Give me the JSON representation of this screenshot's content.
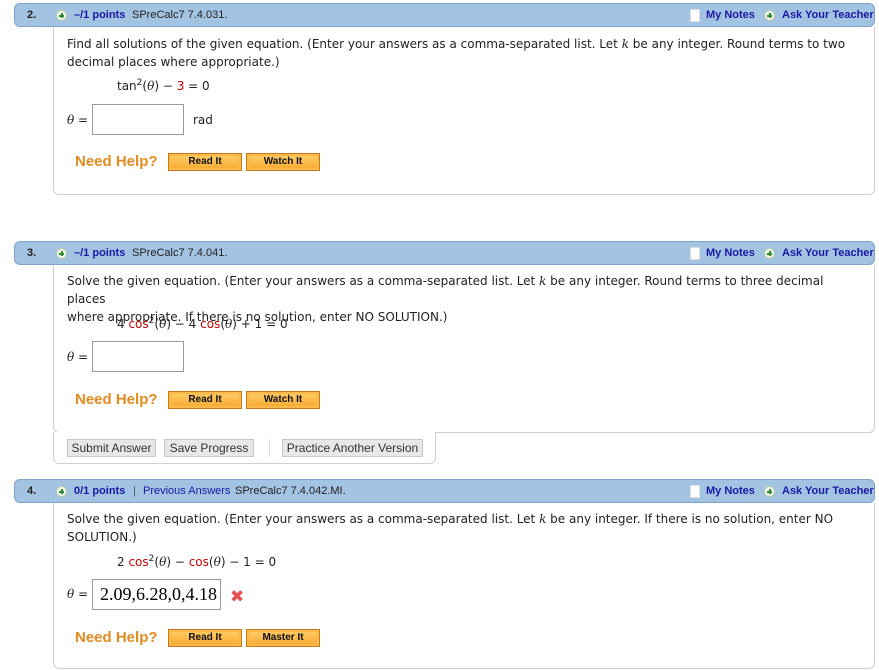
{
  "questions": [
    {
      "number": "2.",
      "points": "–/1 points",
      "source": "SPreCalc7 7.4.031.",
      "my_notes": "My Notes",
      "ask_teacher": "Ask Your Teacher",
      "prompt_line1": "Find all solutions of the given equation. (Enter your answers as a comma-separated list. Let k be any integer. Round terms to two",
      "prompt_line2": "decimal places where appropriate.)",
      "equation": {
        "a": "tan",
        "sup": "2",
        "b": "(θ) − ",
        "c": "3",
        "d": " = 0"
      },
      "theta_label": "θ =",
      "answer_value": "",
      "unit": "rad",
      "need_help": "Need Help?",
      "help_buttons": [
        "Read It",
        "Watch It"
      ]
    },
    {
      "number": "3.",
      "points": "–/1 points",
      "source": "SPreCalc7 7.4.041.",
      "my_notes": "My Notes",
      "ask_teacher": "Ask Your Teacher",
      "prompt_line1": "Solve the given equation. (Enter your answers as a comma-separated list. Let k be any integer. Round terms to three decimal places",
      "prompt_line2": "where appropriate. If there is no solution, enter NO SOLUTION.)",
      "equation": {
        "a": "4 ",
        "b": "cos",
        "sup": "2",
        "c": "(θ) − 4 ",
        "d": "cos",
        "e": "(θ) + 1 = 0"
      },
      "theta_label": "θ =",
      "answer_value": "",
      "need_help": "Need Help?",
      "help_buttons": [
        "Read It",
        "Watch It"
      ],
      "actions": [
        "Submit Answer",
        "Save Progress",
        "Practice Another Version"
      ]
    },
    {
      "number": "4.",
      "points": "0/1 points",
      "separator": "|",
      "previous_answers": "Previous Answers",
      "source": "SPreCalc7 7.4.042.MI.",
      "my_notes": "My Notes",
      "ask_teacher": "Ask Your Teacher",
      "prompt_line1": "Solve the given equation. (Enter your answers as a comma-separated list. Let k be any integer. If there is no solution, enter NO",
      "prompt_line2": "SOLUTION.)",
      "equation": {
        "a": "2 ",
        "b": "cos",
        "sup": "2",
        "c": "(θ) − ",
        "d": "cos",
        "e": "(θ) − 1 = 0"
      },
      "theta_label": "θ =",
      "answer_value": "2.09,6.28,0,4.18",
      "answer_status": "incorrect",
      "need_help": "Need Help?",
      "help_buttons": [
        "Read It",
        "Master It"
      ]
    }
  ],
  "colors": {
    "header_bg": "#a3c3e2",
    "link": "#1a1aa6",
    "need_help": "#e58a1f",
    "help_button": "#f7a82e",
    "equation_red": "#cc0000",
    "incorrect_mark": "#e55050"
  }
}
